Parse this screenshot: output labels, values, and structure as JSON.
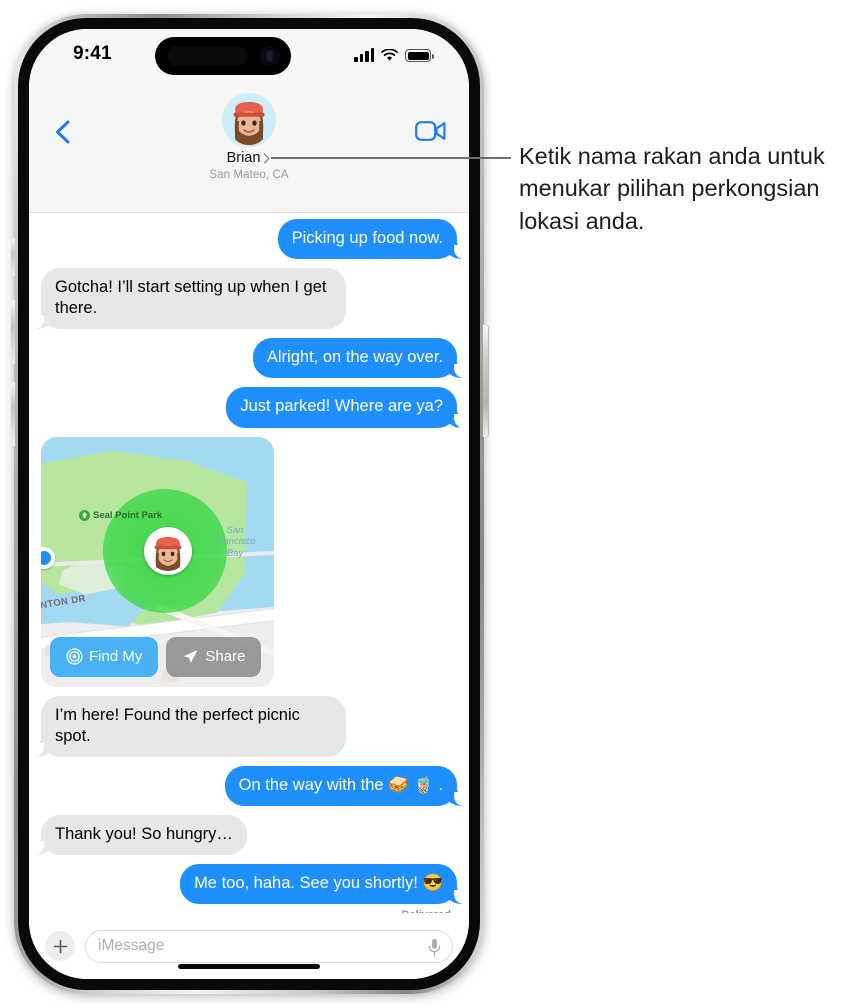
{
  "status_bar": {
    "time": "9:41",
    "cellular_icon": "signal-bars-icon",
    "wifi_icon": "wifi-icon",
    "battery_icon": "battery-full-icon"
  },
  "nav": {
    "back_icon": "back-chevron-icon",
    "facetime_icon": "video-camera-icon",
    "avatar_icon": "memoji-avatar",
    "contact_name": "Brian",
    "contact_chevron_icon": "chevron-right-icon",
    "contact_subtitle": "San Mateo, CA"
  },
  "conversation": {
    "messages": [
      {
        "id": "msg-1",
        "side": "out",
        "text": "Picking up food now."
      },
      {
        "id": "msg-2",
        "side": "in",
        "text": "Gotcha! I’ll start setting up when I get there."
      },
      {
        "id": "msg-3",
        "side": "out",
        "text": "Alright, on the way over."
      },
      {
        "id": "msg-4",
        "side": "out",
        "text": "Just parked! Where are ya?"
      },
      {
        "id": "msg-5",
        "side": "in",
        "text": "I’m here! Found the perfect picnic spot."
      },
      {
        "id": "msg-6",
        "side": "out",
        "text": "On the way with the 🥪 🧋 ."
      },
      {
        "id": "msg-7",
        "side": "in",
        "text": "Thank you! So hungry…"
      },
      {
        "id": "msg-8",
        "side": "out",
        "text": "Me too, haha. See you shortly! 😎"
      }
    ],
    "delivery_status": "Delivered"
  },
  "map_card": {
    "park_label": "Seal Point Park",
    "park_pin_icon": "park-marker-icon",
    "bay_label": "San Francisco Bay",
    "street_label": "INTON DR",
    "me_pin_icon": "memoji-location-pin",
    "friend_dot_icon": "blue-location-dot",
    "buttons": [
      {
        "id": "find-my-button",
        "label": "Find My",
        "icon": "findmy-radar-icon",
        "color": "#49b1f5"
      },
      {
        "id": "share-button",
        "label": "Share",
        "icon": "paper-plane-icon",
        "color": "#828282"
      }
    ]
  },
  "input_bar": {
    "plus_icon": "plus-icon",
    "placeholder": "iMessage",
    "mic_icon": "microphone-icon"
  },
  "annotation": {
    "text": "Ketik nama rakan anda untuk menukar pilihan perkongsian lokasi anda."
  },
  "colors": {
    "outgoing_bubble": "#1f8fff",
    "incoming_bubble": "#e7e7e9",
    "accent_blue": "#007aff",
    "findmy_blue": "#49b1f5",
    "geofence_green": "#3cd746"
  }
}
